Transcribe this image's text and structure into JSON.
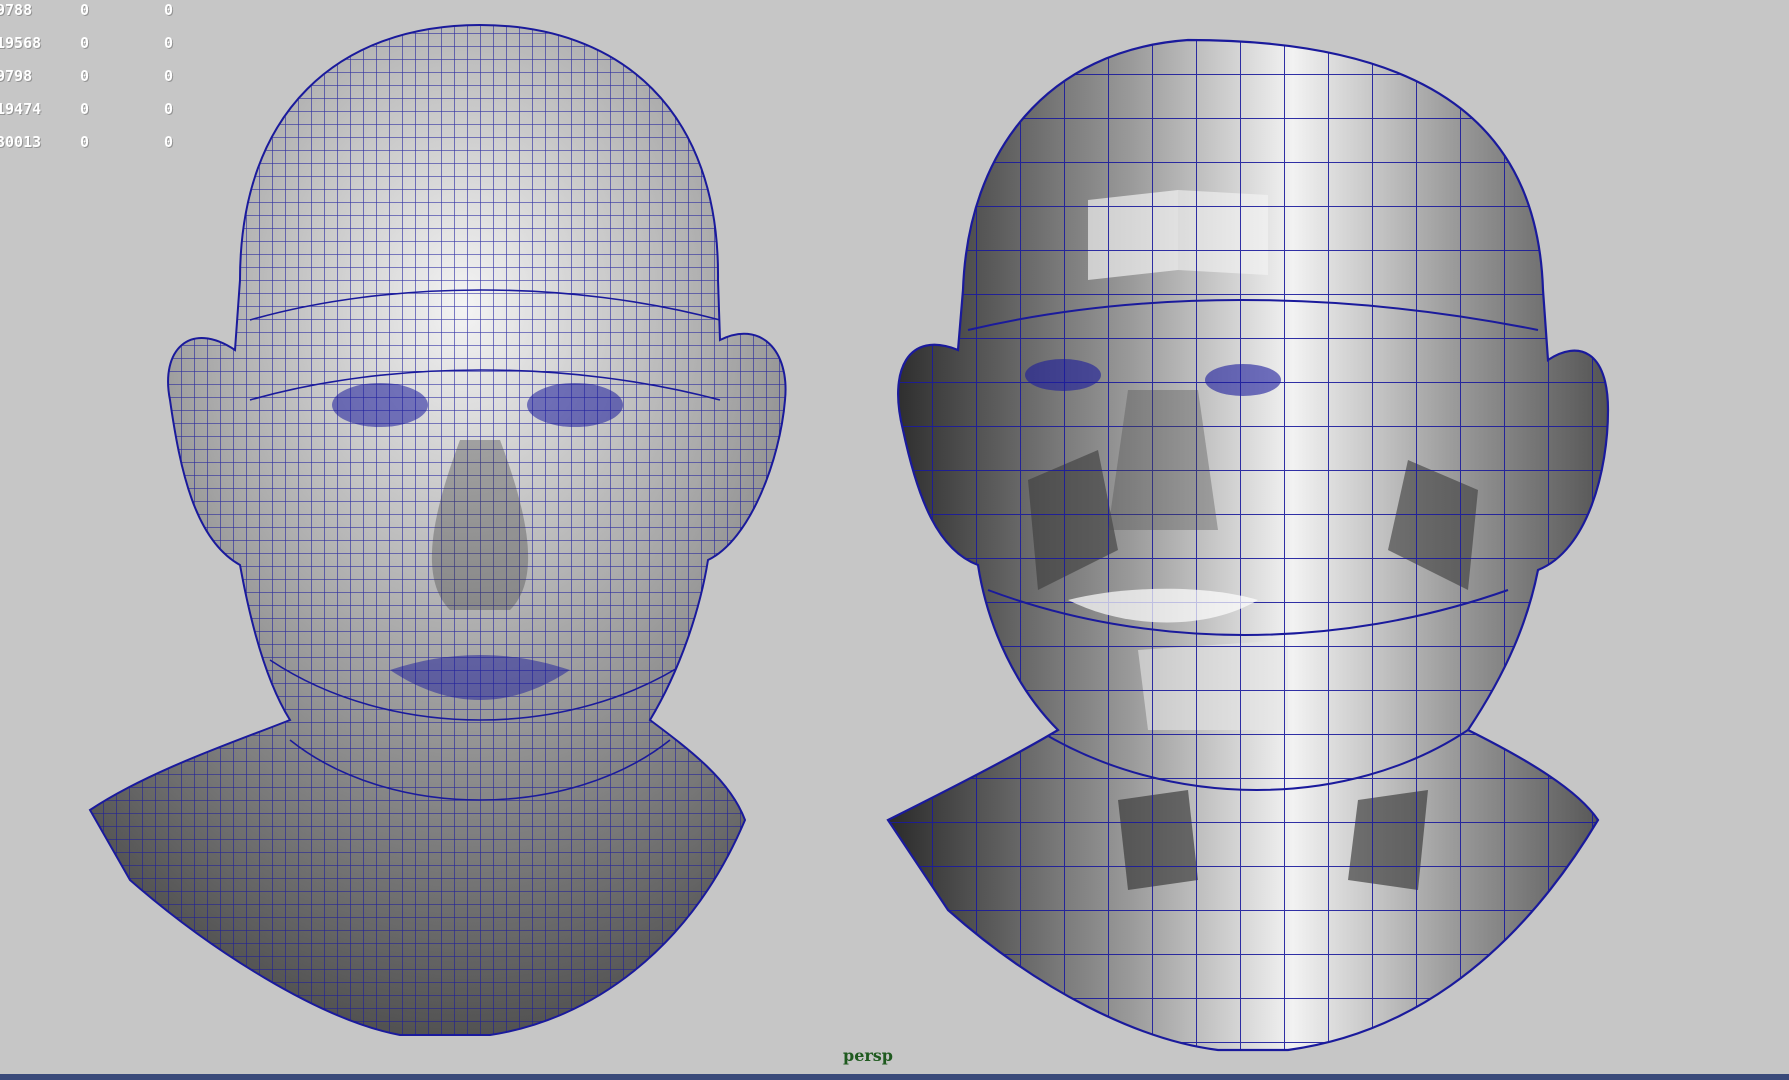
{
  "hud": {
    "rows": [
      [
        "9788",
        "0",
        "0"
      ],
      [
        "19568",
        "0",
        "0"
      ],
      [
        "9798",
        "0",
        "0"
      ],
      [
        "19474",
        "0",
        "0"
      ],
      [
        "30013",
        "0",
        "0"
      ]
    ]
  },
  "viewport": {
    "camera": "persp"
  },
  "colors": {
    "background": "#c6c6c6",
    "wireframe": "#1a1a9c",
    "camera_label": "#1f5a1f",
    "hud_text": "#ffffff"
  },
  "models": [
    {
      "name": "high-density-head-mesh",
      "icon": "wireframe-head"
    },
    {
      "name": "low-poly-head-mesh",
      "icon": "faceted-head"
    }
  ]
}
